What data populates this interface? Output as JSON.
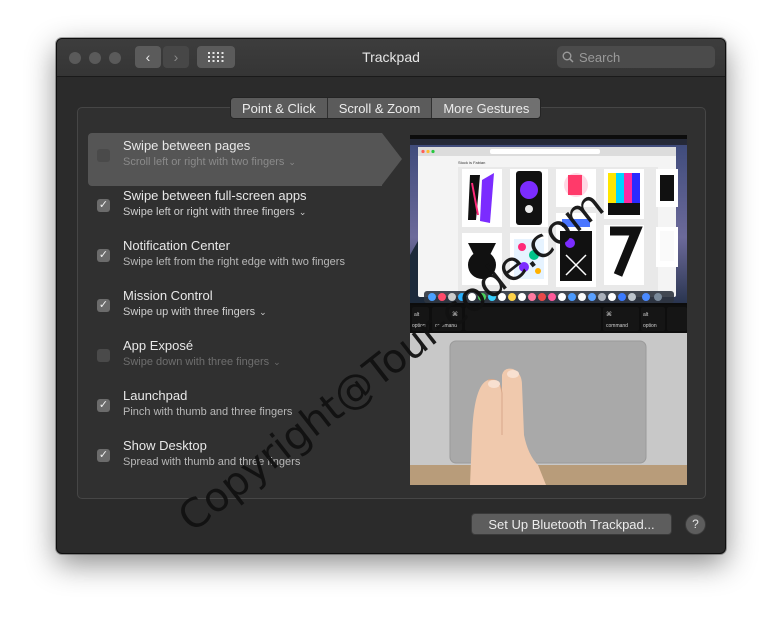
{
  "window": {
    "title": "Trackpad",
    "search_placeholder": "Search",
    "back_glyph": "‹",
    "forward_glyph": "›",
    "grid_glyph": "⋮⋮⋮"
  },
  "tabs": [
    {
      "label": "Point & Click",
      "active": false
    },
    {
      "label": "Scroll & Zoom",
      "active": false
    },
    {
      "label": "More Gestures",
      "active": true
    }
  ],
  "gestures": [
    {
      "title": "Swipe between pages",
      "subtitle": "Scroll left or right with two fingers",
      "checked": false,
      "has_menu": true,
      "selected": true
    },
    {
      "title": "Swipe between full-screen apps",
      "subtitle": "Swipe left or right with three fingers",
      "checked": true,
      "has_menu": true,
      "selected": false
    },
    {
      "title": "Notification Center",
      "subtitle": "Swipe left from the right edge with two fingers",
      "checked": true,
      "has_menu": false,
      "selected": false
    },
    {
      "title": "Mission Control",
      "subtitle": "Swipe up with three fingers",
      "checked": true,
      "has_menu": true,
      "selected": false
    },
    {
      "title": "App Exposé",
      "subtitle": "Swipe down with three fingers",
      "checked": false,
      "has_menu": true,
      "selected": false
    },
    {
      "title": "Launchpad",
      "subtitle": "Pinch with thumb and three fingers",
      "checked": true,
      "has_menu": false,
      "selected": false
    },
    {
      "title": "Show Desktop",
      "subtitle": "Spread with thumb and three fingers",
      "checked": true,
      "has_menu": false,
      "selected": false
    }
  ],
  "preview": {
    "key_left_top": "alt",
    "key_left_bottom": "option",
    "key_cmd_symbol": "⌘",
    "key_cmd_label": "command",
    "key_cmd2_symbol": "⌘",
    "key_cmd2_label": "command",
    "key_right_top": "alt",
    "key_right_bottom": "option",
    "site_label": "Stock is Fabian"
  },
  "footer": {
    "bluetooth_button": "Set Up Bluetooth Trackpad...",
    "help_label": "?"
  },
  "watermark": "Copyright@Tour-code.com",
  "colors": {
    "window_bg": "#2b2b2b",
    "panel_bg": "#303030",
    "selection_bg": "#555555",
    "text": "#e8e8e8",
    "subtext": "#cfcfcf"
  }
}
